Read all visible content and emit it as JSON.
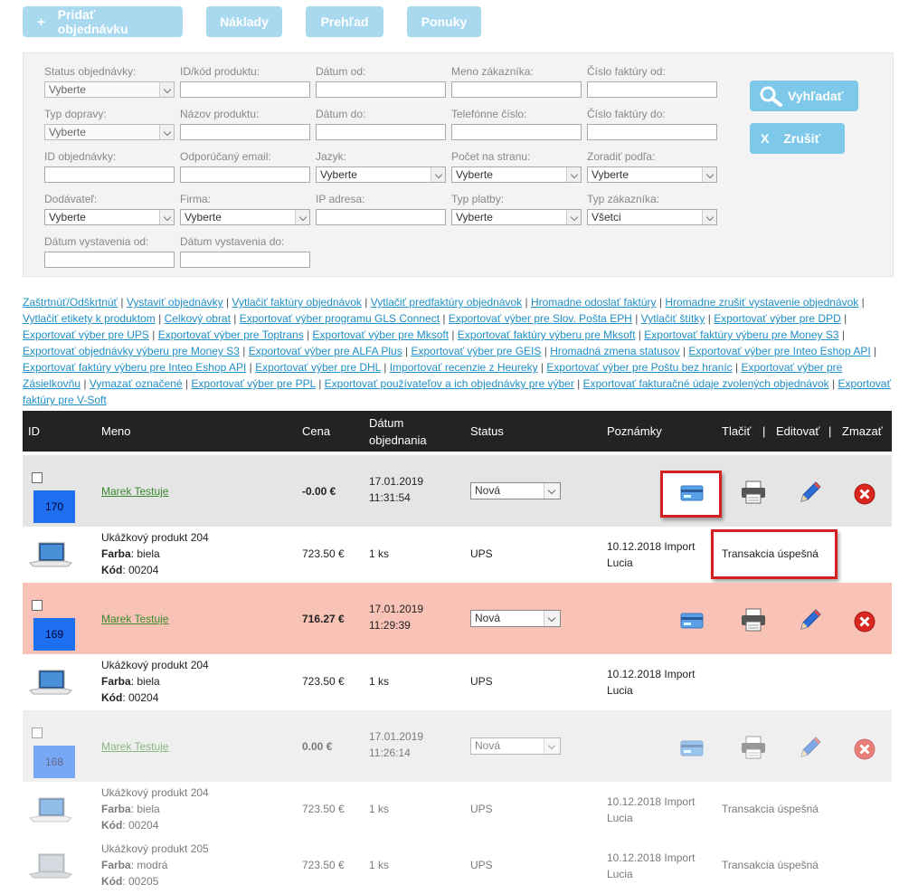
{
  "top_buttons": {
    "add_order": "Pridať objednávku",
    "costs": "Náklady",
    "overview": "Prehľad",
    "offers": "Ponuky"
  },
  "filters": {
    "order_status": {
      "label": "Status objednávky:",
      "value": "Vyberte"
    },
    "product_id": {
      "label": "ID/kód produktu:",
      "value": ""
    },
    "date_from": {
      "label": "Dátum od:",
      "value": ""
    },
    "customer_name": {
      "label": "Meno zákazníka:",
      "value": ""
    },
    "invoice_from": {
      "label": "Číslo faktúry od:",
      "value": ""
    },
    "delivery_type": {
      "label": "Typ dopravy:",
      "value": "Vyberte"
    },
    "product_name": {
      "label": "Názov produktu:",
      "value": ""
    },
    "date_to": {
      "label": "Dátum do:",
      "value": ""
    },
    "phone": {
      "label": "Telefónne číslo:",
      "value": ""
    },
    "invoice_to": {
      "label": "Číslo faktúry do:",
      "value": ""
    },
    "order_id": {
      "label": "ID objednávky:",
      "value": ""
    },
    "referral_email": {
      "label": "Odporúčaný email:",
      "value": ""
    },
    "language": {
      "label": "Jazyk:",
      "value": "Vyberte"
    },
    "per_page": {
      "label": "Počet na stranu:",
      "value": "Vyberte"
    },
    "sort_by": {
      "label": "Zoradiť podľa:",
      "value": "Vyberte"
    },
    "supplier": {
      "label": "Dodávateľ:",
      "value": "Vyberte"
    },
    "company": {
      "label": "Firma:",
      "value": "Vyberte"
    },
    "ip_address": {
      "label": "IP adresa:",
      "value": ""
    },
    "payment_type": {
      "label": "Typ platby:",
      "value": "Vyberte"
    },
    "customer_type": {
      "label": "Typ zákazníka:",
      "value": "Všetci"
    },
    "issue_date_from": {
      "label": "Dátum vystavenia od:",
      "value": ""
    },
    "issue_date_to": {
      "label": "Dátum vystavenia do:",
      "value": ""
    },
    "search_button": "Vyhľadať",
    "cancel_button": "Zrušiť",
    "cancel_icon": "X"
  },
  "action_links": [
    "Zaštrtnúť/Odškrtnúť",
    "Vystaviť objednávky",
    "Vytlačiť faktúry objednávok",
    "Vytlačiť predfaktúry objednávok",
    "Hromadne odoslať faktúry",
    "Hromadne zrušiť vystavenie objednávok",
    "Vytlačiť etikety k produktom",
    "Celkový obrat",
    "Exportovať výber programu GLS Connect",
    "Exportovať výber pre Slov. Pošta EPH",
    "Vytlačiť štítky",
    "Exportovať výber pre DPD",
    "Exportovať výber pre UPS",
    "Exportovať výber pre Toptrans",
    "Exportovať výber pre Mksoft",
    "Exportovať faktúry výberu pre Mksoft",
    "Exportovať faktúry výberu pre Money S3",
    "Exportovať objednávky výberu pre Money S3",
    "Exportovať výber pre ALFA Plus",
    "Exportovať výber pre GEIS",
    "Hromadná zmena statusov",
    "Exportovať výber pre Inteo Eshop API",
    "Exportovať faktúry výberu pre Inteo Eshop API",
    "Exportovať výber pre DHL",
    "Importovať recenzie z Heureky",
    "Exportovať výber pre Poštu bez hraníc",
    "Exportovať výber pre Zásielkovňu",
    "Vymazať označené",
    "Exportovať výber pre PPL",
    "Exportovať používateľov a ich objednávky pre výber",
    "Exportovať fakturačné údaje zvolených objednávok",
    "Exportovať faktúry pre V-Soft"
  ],
  "table_header": {
    "id": "ID",
    "name": "Meno",
    "price": "Cena",
    "date_line1": "Dátum",
    "date_line2": "objednania",
    "status": "Status",
    "notes": "Poznámky",
    "print": "Tlačiť",
    "sep1": "|",
    "edit": "Editovať",
    "sep2": "|",
    "delete": "Zmazať"
  },
  "orders": [
    {
      "id": "170",
      "name": "Marek Testuje",
      "price": "-0.00 €",
      "date": "17.01.2019",
      "time": "11:31:54",
      "status": "Nová",
      "product": {
        "name": "Ukážkový produkt 204",
        "color_label": "Farba",
        "color": ": biela",
        "code_label": "Kód",
        "code": ": 00204",
        "price": "723.50 €",
        "qty": "1 ks",
        "shipping": "UPS",
        "note1": "10.12.2018 Import",
        "note2": "Lucia",
        "transaction": "Transakcia úspešná"
      }
    },
    {
      "id": "169",
      "name": "Marek Testuje",
      "price": "716.27 €",
      "date": "17.01.2019",
      "time": "11:29:39",
      "status": "Nová",
      "product": {
        "name": "Ukážkový produkt 204",
        "color_label": "Farba",
        "color": ": biela",
        "code_label": "Kód",
        "code": ": 00204",
        "price": "723.50 €",
        "qty": "1 ks",
        "shipping": "UPS",
        "note1": "10.12.2018 Import",
        "note2": "Lucia"
      }
    },
    {
      "id": "168",
      "name": "Marek Testuje",
      "price": "0.00 €",
      "date": "17.01.2019",
      "time": "11:26:14",
      "status": "Nová",
      "products": [
        {
          "name": "Ukážkový produkt 204",
          "color_label": "Farba",
          "color": ": biela",
          "code_label": "Kód",
          "code": ": 00204",
          "price": "723.50 €",
          "qty": "1 ks",
          "shipping": "UPS",
          "note1": "10.12.2018 Import",
          "note2": "Lucia",
          "transaction": "Transakcia úspešná"
        },
        {
          "name": "Ukážkový produkt 205",
          "color_label": "Farba",
          "color": ": modrá",
          "code_label": "Kód",
          "code": ": 00205",
          "price": "723.50 €",
          "qty": "1 ks",
          "shipping": "UPS",
          "note1": "10.12.2018 Import",
          "note2": "Lucia",
          "transaction": "Transakcia úspešná"
        }
      ]
    }
  ],
  "colors": {
    "accent": "#7ec9ea",
    "header_bg": "#232323",
    "row_gray": "#e5e5e5",
    "row_pink": "#f9c2b6",
    "id_blue": "#1e6fef",
    "link": "#1e8fc7",
    "name_green": "#3a8a2d",
    "highlight_red": "#d42020"
  }
}
